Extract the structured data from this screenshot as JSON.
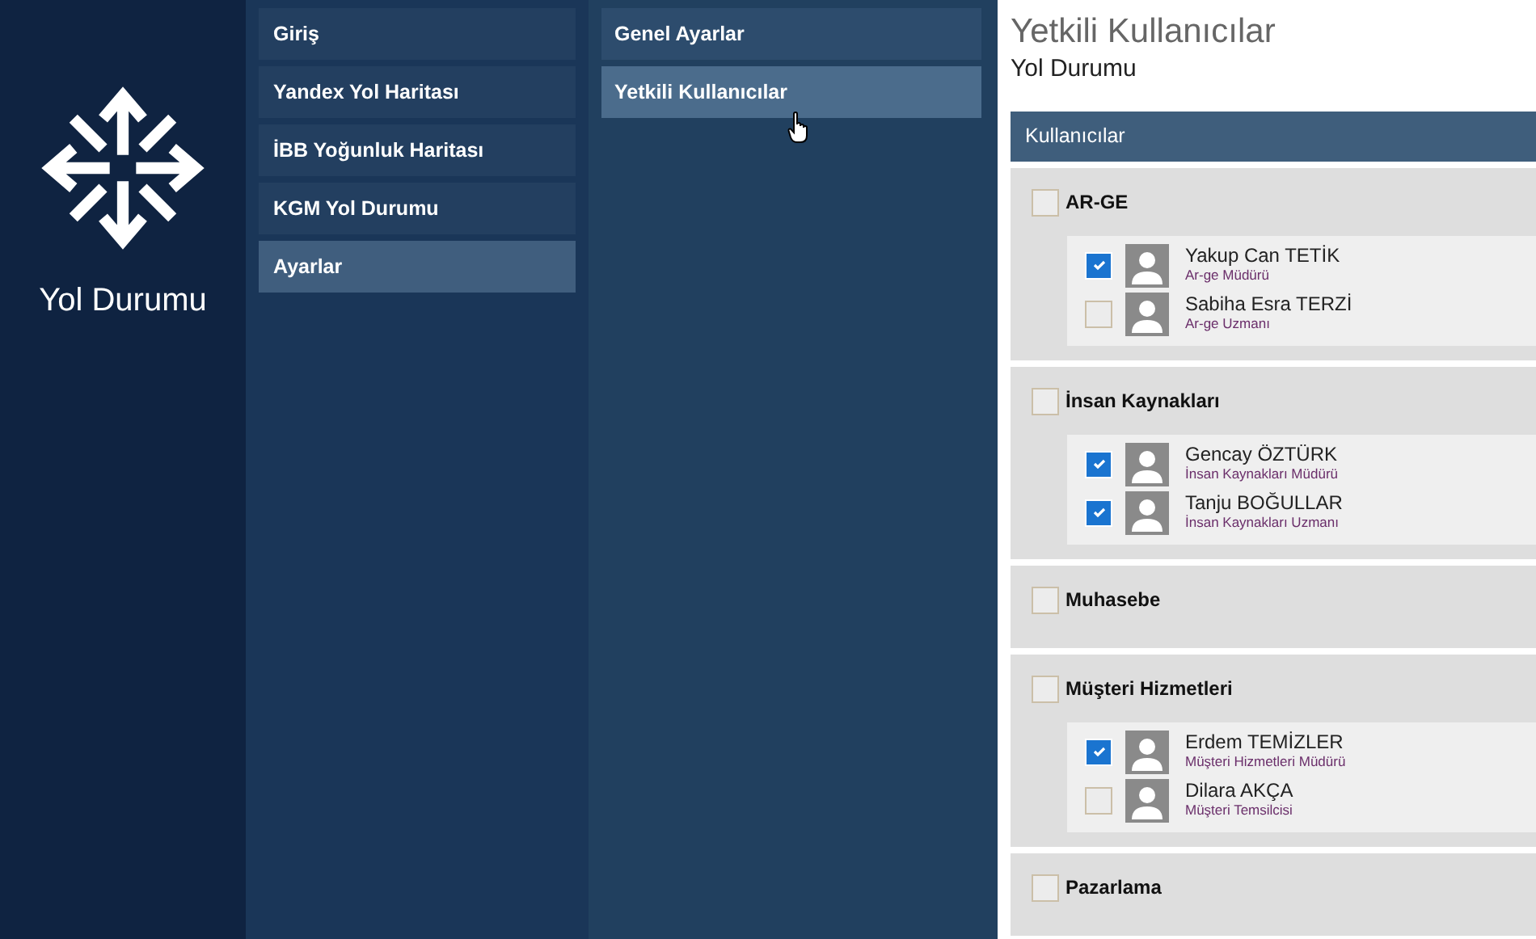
{
  "app": {
    "title": "Yol Durumu"
  },
  "menu": [
    {
      "label": "Giriş",
      "selected": false
    },
    {
      "label": "Yandex Yol Haritası",
      "selected": false
    },
    {
      "label": "İBB Yoğunluk Haritası",
      "selected": false
    },
    {
      "label": "KGM Yol Durumu",
      "selected": false
    },
    {
      "label": "Ayarlar",
      "selected": true
    }
  ],
  "submenu": [
    {
      "label": "Genel Ayarlar",
      "selected": false
    },
    {
      "label": "Yetkili Kullanıcılar",
      "selected": true
    }
  ],
  "page": {
    "title": "Yetkili Kullanıcılar",
    "subtitle": "Yol Durumu"
  },
  "panel": {
    "header": "Kullanıcılar"
  },
  "groups": [
    {
      "name": "AR-GE",
      "checked": false,
      "users": [
        {
          "name": "Yakup Can TETİK",
          "role": "Ar-ge Müdürü",
          "checked": true
        },
        {
          "name": "Sabiha Esra TERZİ",
          "role": "Ar-ge Uzmanı",
          "checked": false
        }
      ]
    },
    {
      "name": "İnsan Kaynakları",
      "checked": false,
      "users": [
        {
          "name": "Gencay ÖZTÜRK",
          "role": "İnsan Kaynakları Müdürü",
          "checked": true
        },
        {
          "name": "Tanju BOĞULLAR",
          "role": "İnsan Kaynakları Uzmanı",
          "checked": true
        }
      ]
    },
    {
      "name": "Muhasebe",
      "checked": false
    },
    {
      "name": "Müşteri Hizmetleri",
      "checked": false,
      "users": [
        {
          "name": "Erdem TEMİZLER",
          "role": "Müşteri Hizmetleri Müdürü",
          "checked": true
        },
        {
          "name": "Dilara AKÇA",
          "role": "Müşteri Temsilcisi",
          "checked": false
        }
      ]
    },
    {
      "name": "Pazarlama",
      "checked": false
    }
  ]
}
